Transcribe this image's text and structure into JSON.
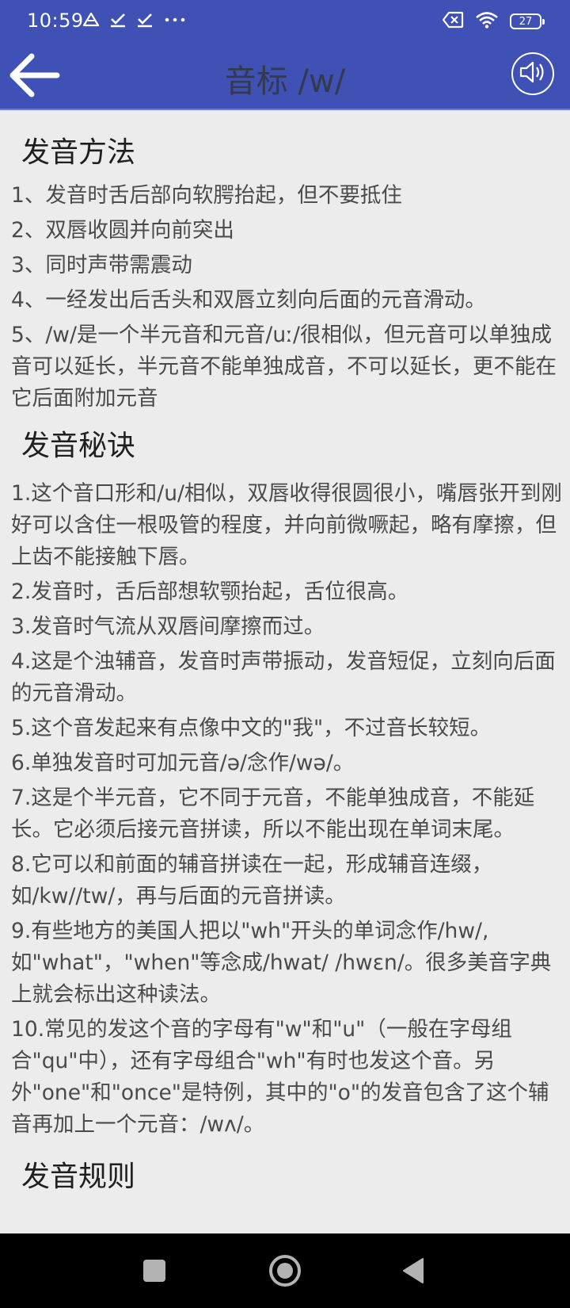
{
  "status_bar": {
    "time": "10:59",
    "left_icons": [
      "drive-icon",
      "check-icon",
      "check-icon",
      "more-icon"
    ],
    "right_icons": [
      "sim-off-icon",
      "wifi-icon",
      "battery-icon"
    ],
    "battery_level": "27"
  },
  "app_bar": {
    "title": "音标 /w/",
    "back_icon": "arrow-left-icon",
    "speaker_icon": "speaker-icon"
  },
  "sections": [
    {
      "heading": "发音方法",
      "items": [
        "1、发音时舌后部向软腭抬起，但不要抵住",
        "2、双唇收圆并向前突出",
        "3、同时声带需震动",
        "4、一经发出后舌头和双唇立刻向后面的元音滑动。",
        "5、/w/是一个半元音和元音/uː/很相似，但元音可以单独成音可以延长，半元音不能单独成音，不可以延长，更不能在它后面附加元音"
      ]
    },
    {
      "heading": "发音秘诀",
      "items": [
        "1.这个音口形和/u/相似，双唇收得很圆很小，嘴唇张开到刚好可以含住一根吸管的程度，并向前微噘起，略有摩擦，但上齿不能接触下唇。",
        "2.发音时，舌后部想软颚抬起，舌位很高。",
        "3.发音时气流从双唇间摩擦而过。",
        "4.这是个浊辅音，发音时声带振动，发音短促，立刻向后面的元音滑动。",
        "5.这个音发起来有点像中文的\"我\"，不过音长较短。",
        "6.单独发音时可加元音/ə/念作/wə/。",
        "7.这是个半元音，它不同于元音，不能单独成音，不能延长。它必须后接元音拼读，所以不能出现在单词末尾。",
        "8.它可以和前面的辅音拼读在一起，形成辅音连缀，如/kw//tw/，再与后面的元音拼读。",
        "9.有些地方的美国人把以\"wh\"开头的单词念作/hw/,如\"what\"，\"when\"等念成/hwat/ /hwɛn/。很多美音字典上就会标出这种读法。",
        "10.常见的发这个音的字母有\"w\"和\"u\"（一般在字母组合\"qu\"中），还有字母组合\"wh\"有时也发这个音。另外\"one\"和\"once\"是特例，其中的\"o\"的发音包含了这个辅音再加上一个元音：/wʌ/。"
      ]
    },
    {
      "heading": "发音规则",
      "items": []
    }
  ],
  "nav_bar": {
    "recents_icon": "square-icon",
    "home_icon": "circle-icon",
    "back_icon": "triangle-back-icon"
  },
  "colors": {
    "app_bar": "#3f51b5",
    "background": "#ececec",
    "nav_bar": "#000000"
  }
}
